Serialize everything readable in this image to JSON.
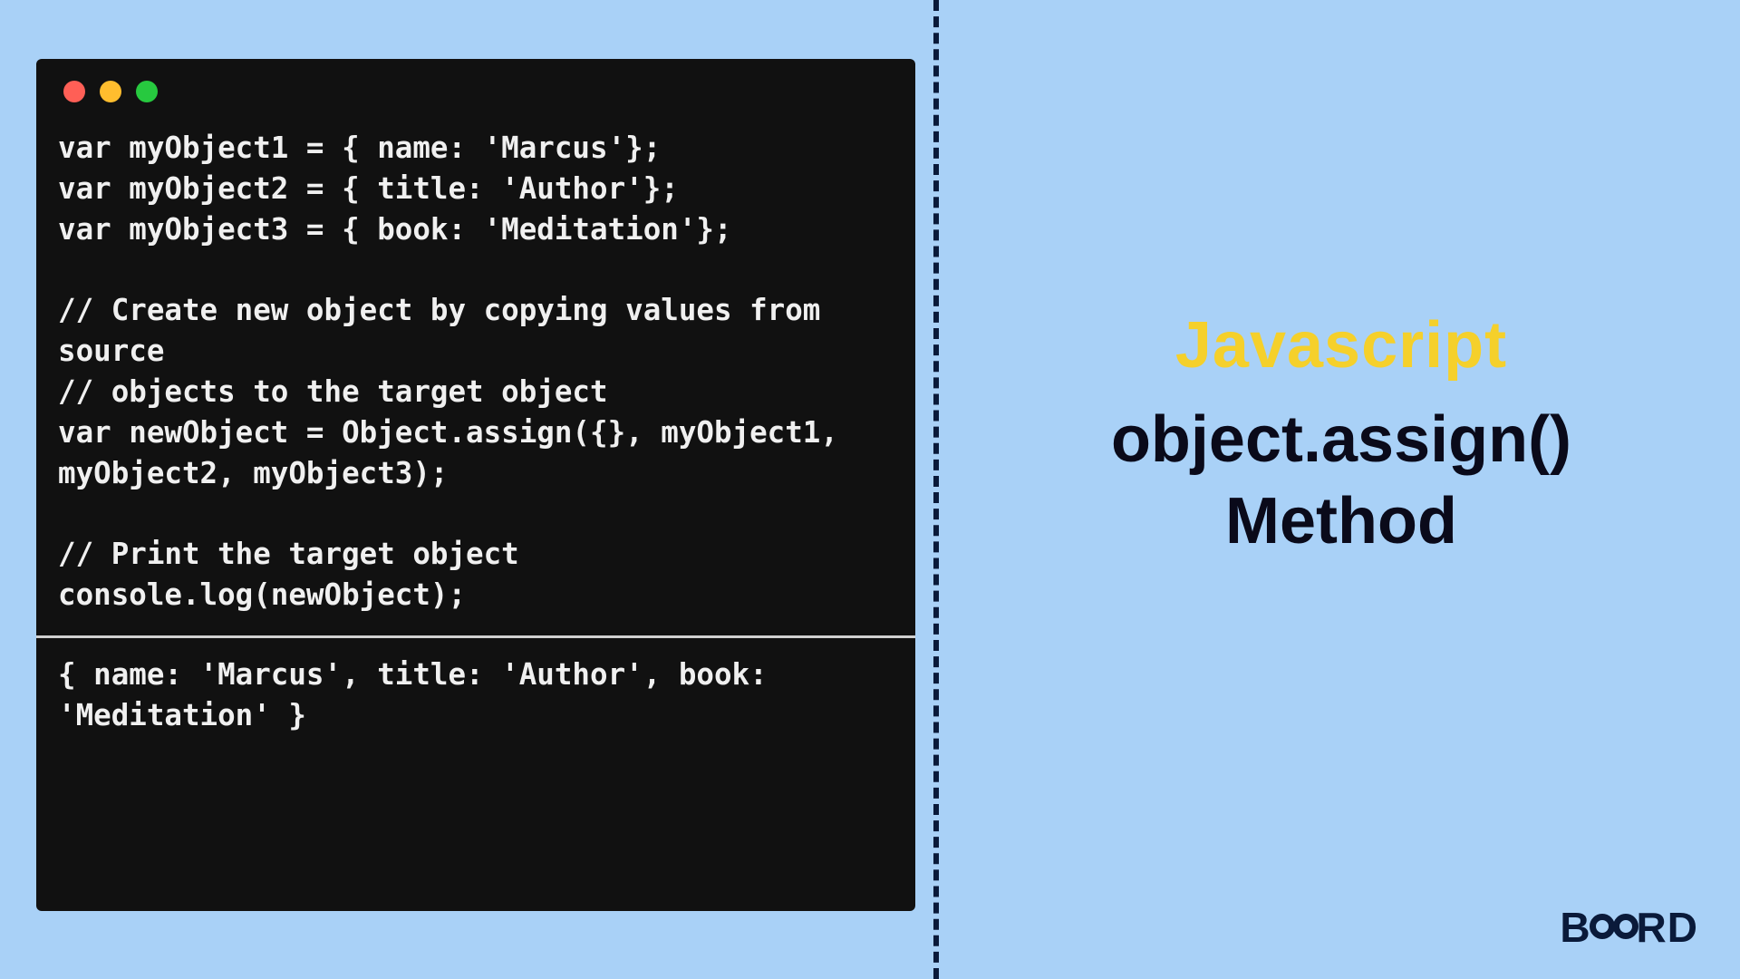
{
  "code": {
    "lines": "var myObject1 = { name: 'Marcus'};\nvar myObject2 = { title: 'Author'};\nvar myObject3 = { book: 'Meditation'};\n\n// Create new object by copying values from source\n// objects to the target object\nvar newObject = Object.assign({}, myObject1, myObject2, myObject3);\n\n// Print the target object\nconsole.log(newObject);",
    "output": "{ name: 'Marcus', title: 'Author', book: 'Meditation' }"
  },
  "title": {
    "line1": "Javascript",
    "line2": "object.assign()",
    "line3": "Method"
  },
  "logo": {
    "left": "B",
    "right": "RD"
  },
  "colors": {
    "background": "#a9d1f7",
    "accent_yellow": "#f5d02b",
    "code_bg": "#111111"
  }
}
